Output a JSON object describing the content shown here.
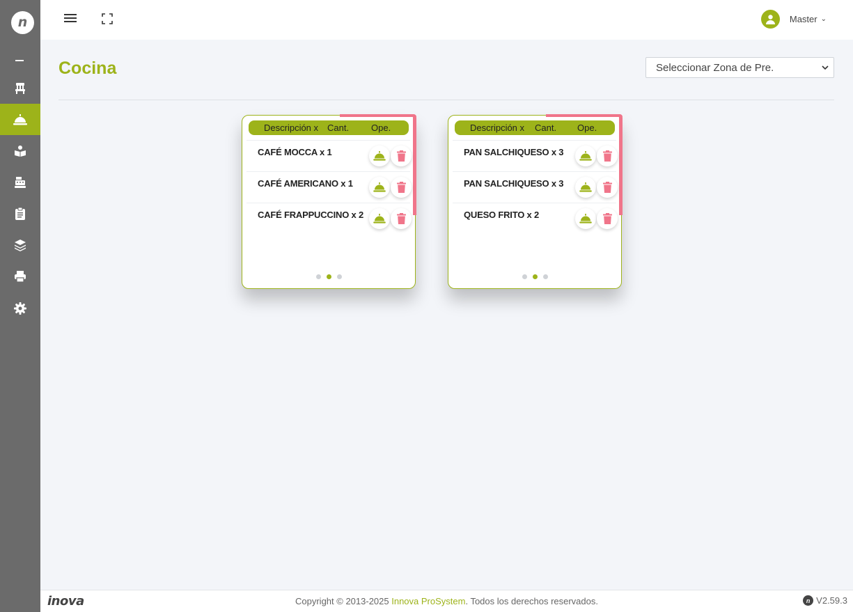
{
  "app": {
    "logo_glyph": "n",
    "footer_logo": "inova"
  },
  "colors": {
    "accent": "#9db31a",
    "sidebar": "#6b6b6b",
    "danger": "#f0758a",
    "background": "#f3f5f9"
  },
  "sidebar": {
    "items": [
      {
        "icon": "chair-icon",
        "active": false
      },
      {
        "icon": "service-bell-icon",
        "active": true
      },
      {
        "icon": "book-icon",
        "active": false
      },
      {
        "icon": "cash-register-icon",
        "active": false
      },
      {
        "icon": "clipboard-icon",
        "active": false
      },
      {
        "icon": "layers-icon",
        "active": false
      },
      {
        "icon": "printer-icon",
        "active": false
      },
      {
        "icon": "gear-icon",
        "active": false
      }
    ]
  },
  "topbar": {
    "user_name": "Master",
    "chevron": "⌄"
  },
  "header": {
    "title": "Cocina",
    "zone_select": "Seleccionar Zona de Pre."
  },
  "cards": [
    {
      "columns": {
        "description": "Descripción x",
        "quantity": "Cant.",
        "operation": "Ope."
      },
      "items": [
        {
          "text": "CAFÉ MOCCA x 1"
        },
        {
          "text": "CAFÉ AMERICANO x 1"
        },
        {
          "text": "CAFÉ FRAPPUCCINO x 2"
        }
      ],
      "active_page": 1
    },
    {
      "columns": {
        "description": "Descripción x",
        "quantity": "Cant.",
        "operation": "Ope."
      },
      "items": [
        {
          "text": "PAN SALCHIQUESO x 3"
        },
        {
          "text": "PAN SALCHIQUESO x 3"
        },
        {
          "text": "QUESO FRITO x 2"
        }
      ],
      "active_page": 1
    }
  ],
  "footer": {
    "copyright_prefix": "Copyright © 2013-2025 ",
    "brand": "Innova ProSystem",
    "copyright_suffix": ". Todos los derechos reservados.",
    "version": "V2.59.3"
  }
}
